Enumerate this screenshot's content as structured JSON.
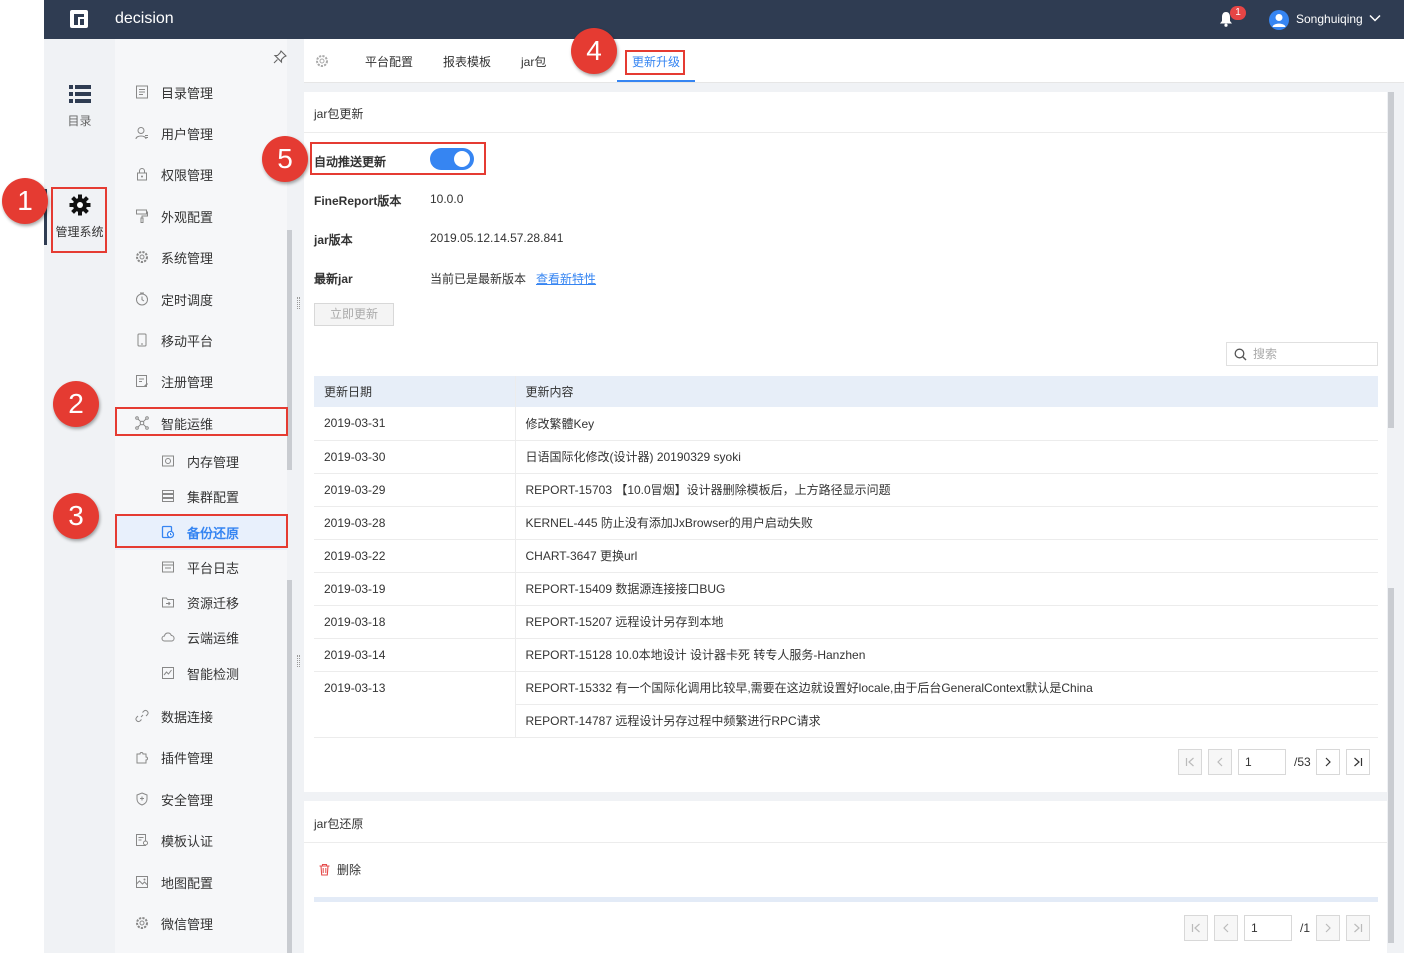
{
  "header": {
    "app_title": "decision",
    "notification_count": "1",
    "user_name": "Songhuiqing"
  },
  "rail": {
    "items": [
      {
        "label": "目录"
      },
      {
        "label": "管理系统"
      }
    ]
  },
  "menu": {
    "items": [
      {
        "label": "目录管理"
      },
      {
        "label": "用户管理"
      },
      {
        "label": "权限管理"
      },
      {
        "label": "外观配置"
      },
      {
        "label": "系统管理"
      },
      {
        "label": "定时调度"
      },
      {
        "label": "移动平台"
      },
      {
        "label": "注册管理"
      },
      {
        "label": "智能运维"
      },
      {
        "label": "内存管理"
      },
      {
        "label": "集群配置"
      },
      {
        "label": "备份还原"
      },
      {
        "label": "平台日志"
      },
      {
        "label": "资源迁移"
      },
      {
        "label": "云端运维"
      },
      {
        "label": "智能检测"
      },
      {
        "label": "数据连接"
      },
      {
        "label": "插件管理"
      },
      {
        "label": "安全管理"
      },
      {
        "label": "模板认证"
      },
      {
        "label": "地图配置"
      },
      {
        "label": "微信管理"
      }
    ],
    "active": "备份还原"
  },
  "tabs": [
    {
      "label": "平台配置"
    },
    {
      "label": "报表模板"
    },
    {
      "label": "jar包"
    },
    {
      "label": "更新升级"
    }
  ],
  "jar_update": {
    "section_title": "jar包更新",
    "auto_push_label": "自动推送更新",
    "auto_push_on": true,
    "fr_version_label": "FineReport版本",
    "fr_version_value": "10.0.0",
    "jar_version_label": "jar版本",
    "jar_version_value": "2019.05.12.14.57.28.841",
    "latest_jar_label": "最新jar",
    "latest_jar_value": "当前已是最新版本",
    "view_features_link": "查看新特性",
    "update_now_button": "立即更新",
    "search_placeholder": "搜索",
    "table": {
      "col_date": "更新日期",
      "col_content": "更新内容",
      "rows": [
        {
          "date": "2019-03-31",
          "content": "修改繁體Key"
        },
        {
          "date": "2019-03-30",
          "content": "日语国际化修改(设计器) 20190329 syoki"
        },
        {
          "date": "2019-03-29",
          "content": "REPORT-15703 【10.0冒烟】设计器删除模板后，上方路径显示问题"
        },
        {
          "date": "2019-03-28",
          "content": "KERNEL-445 防止没有添加JxBrowser的用户启动失败"
        },
        {
          "date": "2019-03-22",
          "content": "CHART-3647 更换url"
        },
        {
          "date": "2019-03-19",
          "content": "REPORT-15409 数据源连接接口BUG"
        },
        {
          "date": "2019-03-18",
          "content": "REPORT-15207 远程设计另存到本地"
        },
        {
          "date": "2019-03-14",
          "content": "REPORT-15128 10.0本地设计 设计器卡死 转专人服务-Hanzhen"
        },
        {
          "date": "2019-03-13",
          "content": "REPORT-15332 有一个国际化调用比较早,需要在这边就设置好locale,由于后台GeneralContext默认是China"
        },
        {
          "date": "",
          "content": "REPORT-14787 远程设计另存过程中频繁进行RPC请求"
        }
      ]
    },
    "pager": {
      "current": "1",
      "total": "/53"
    }
  },
  "jar_restore": {
    "section_title": "jar包还原",
    "delete_label": "删除",
    "pager": {
      "current": "1",
      "total": "/1"
    }
  },
  "annotations": [
    "1",
    "2",
    "3",
    "4",
    "5"
  ],
  "colors": {
    "header_bg": "#2f3c52",
    "accent": "#3685f2",
    "annotation_red": "#e53b32"
  }
}
